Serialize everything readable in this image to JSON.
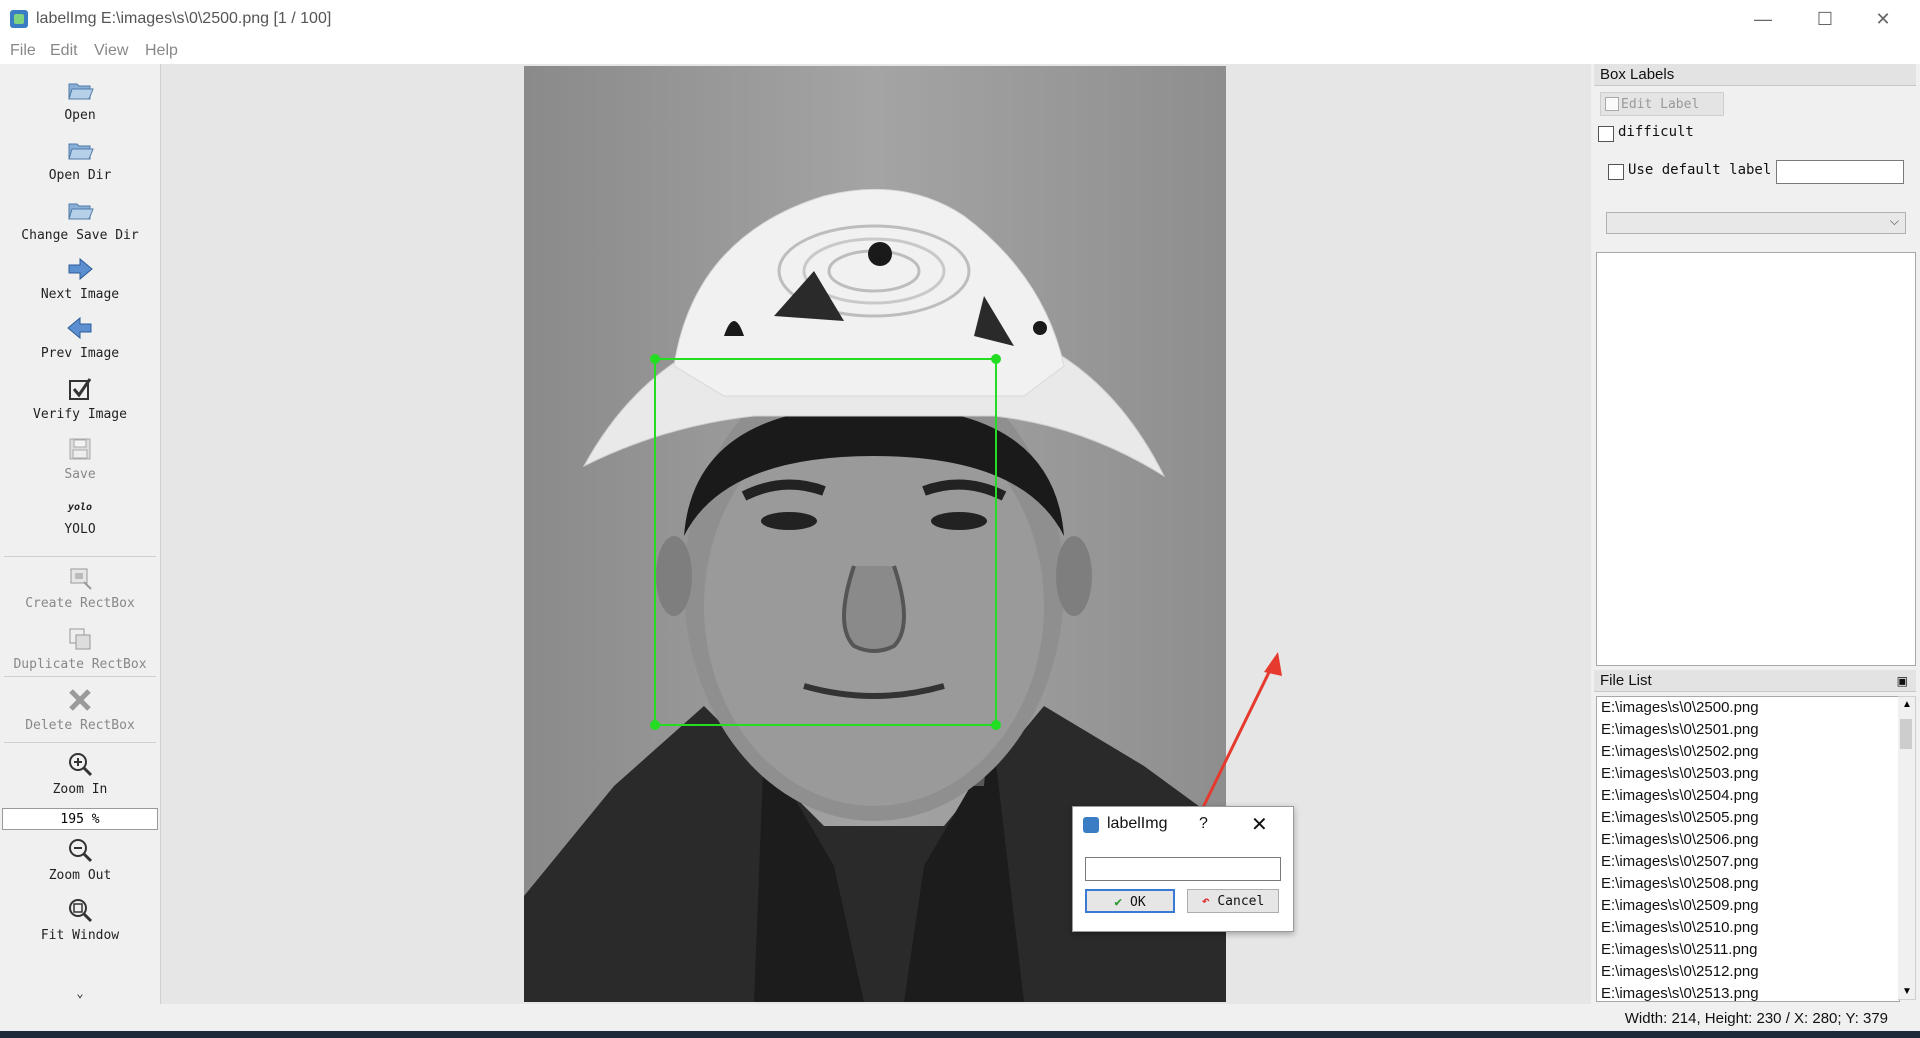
{
  "window": {
    "title": "labelImg E:\\images\\s\\0\\2500.png [1 / 100]",
    "minimize": "—",
    "maximize": "☐",
    "close": "✕"
  },
  "menu": [
    "File",
    "Edit",
    "View",
    "Help"
  ],
  "toolbar": {
    "open": "Open",
    "open_dir": "Open Dir",
    "change_save_dir": "Change Save Dir",
    "next_image": "Next Image",
    "prev_image": "Prev Image",
    "verify_image": "Verify Image",
    "save": "Save",
    "format_icon_text": "yolo",
    "format": "YOLO",
    "create_rectbox": "Create RectBox",
    "duplicate_rectbox": "Duplicate RectBox",
    "delete_rectbox": "Delete RectBox",
    "zoom_in": "Zoom In",
    "zoom_value": "195 %",
    "zoom_out": "Zoom Out",
    "fit_window": "Fit Window",
    "more": "⌄"
  },
  "box_labels": {
    "header": "Box Labels",
    "edit_label": "Edit Label",
    "difficult": "difficult",
    "use_default_label": "Use default label"
  },
  "file_list": {
    "header": "File List",
    "files": [
      "E:\\images\\s\\0\\2500.png",
      "E:\\images\\s\\0\\2501.png",
      "E:\\images\\s\\0\\2502.png",
      "E:\\images\\s\\0\\2503.png",
      "E:\\images\\s\\0\\2504.png",
      "E:\\images\\s\\0\\2505.png",
      "E:\\images\\s\\0\\2506.png",
      "E:\\images\\s\\0\\2507.png",
      "E:\\images\\s\\0\\2508.png",
      "E:\\images\\s\\0\\2509.png",
      "E:\\images\\s\\0\\2510.png",
      "E:\\images\\s\\0\\2511.png",
      "E:\\images\\s\\0\\2512.png",
      "E:\\images\\s\\0\\2513.png"
    ]
  },
  "status": "Width: 214, Height: 230 / X: 280; Y: 379",
  "dialog": {
    "title": "labelImg",
    "help": "?",
    "close": "✕",
    "ok": "OK",
    "cancel": "Cancel"
  },
  "colors": {
    "bbox": "#22dd22",
    "accent": "#3a7ad4",
    "arrow": "#e63a2e"
  }
}
